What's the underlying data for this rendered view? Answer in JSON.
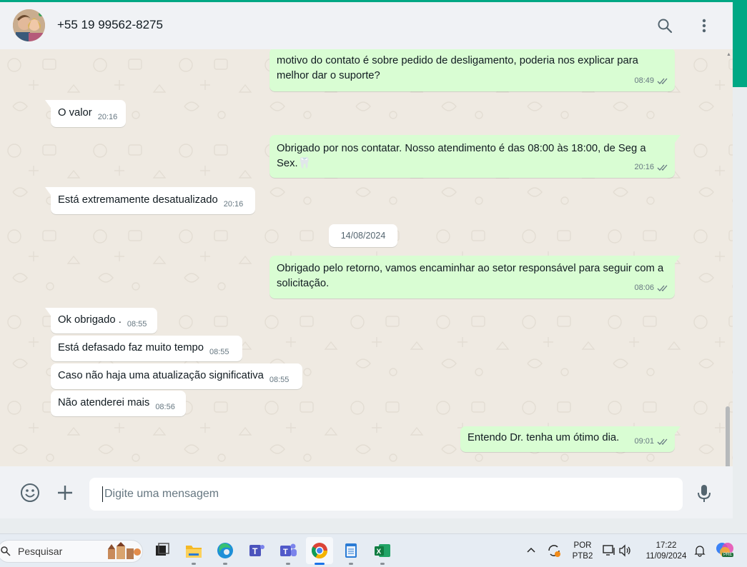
{
  "header": {
    "contact_name": "+55 19 99562-8275",
    "icons": [
      "search-icon",
      "kebab-menu-icon"
    ]
  },
  "messages": [
    {
      "dir": "out",
      "text": "motivo do contato é  sobre pedido de desligamento, poderia nos explicar para melhor dar o suporte?",
      "time": "08:49"
    },
    {
      "dir": "in",
      "text": "O valor",
      "time": "20:16"
    },
    {
      "dir": "out",
      "text": "Obrigado por nos contatar. Nosso atendimento é das 08:00 às 18:00, de Seg a Sex.🦷",
      "time": "20:16"
    },
    {
      "dir": "in",
      "text": "Está extremamente desatualizado",
      "time": "20:16"
    },
    {
      "dir": "out",
      "text": "Obrigado pelo retorno, vamos encaminhar ao setor responsável para seguir com a solicitação.",
      "time": "08:06"
    },
    {
      "dir": "in",
      "text": "Ok obrigado .",
      "time": "08:55"
    },
    {
      "dir": "in",
      "text": "Está defasado faz muito tempo",
      "time": "08:55"
    },
    {
      "dir": "in",
      "text": "Caso não haja uma atualização significativa",
      "time": "08:55"
    },
    {
      "dir": "in",
      "text": "Não atenderei mais",
      "time": "08:56"
    },
    {
      "dir": "out",
      "text": "Entendo Dr. tenha um ótimo dia.",
      "time": "09:01"
    }
  ],
  "date_divider": "14/08/2024",
  "composer": {
    "placeholder": "Digite uma mensagem",
    "icons": [
      "emoji-icon",
      "plus-icon",
      "microphone-icon"
    ]
  },
  "taskbar": {
    "search_label": "Pesquisar",
    "apps": [
      "task-view",
      "file-explorer",
      "edge",
      "teams-education",
      "teams",
      "chrome",
      "notepad",
      "excel"
    ],
    "language": "POR",
    "keyboard": "PTB2",
    "clock_time": "17:22",
    "clock_date": "11/09/2024",
    "copilot_badge": "PRE"
  },
  "colors": {
    "accent": "#00a884",
    "outgoing_bubble": "#d9fdd3",
    "incoming_bubble": "#ffffff",
    "chat_bg": "#efeae2",
    "read_ticks": "#667781"
  }
}
